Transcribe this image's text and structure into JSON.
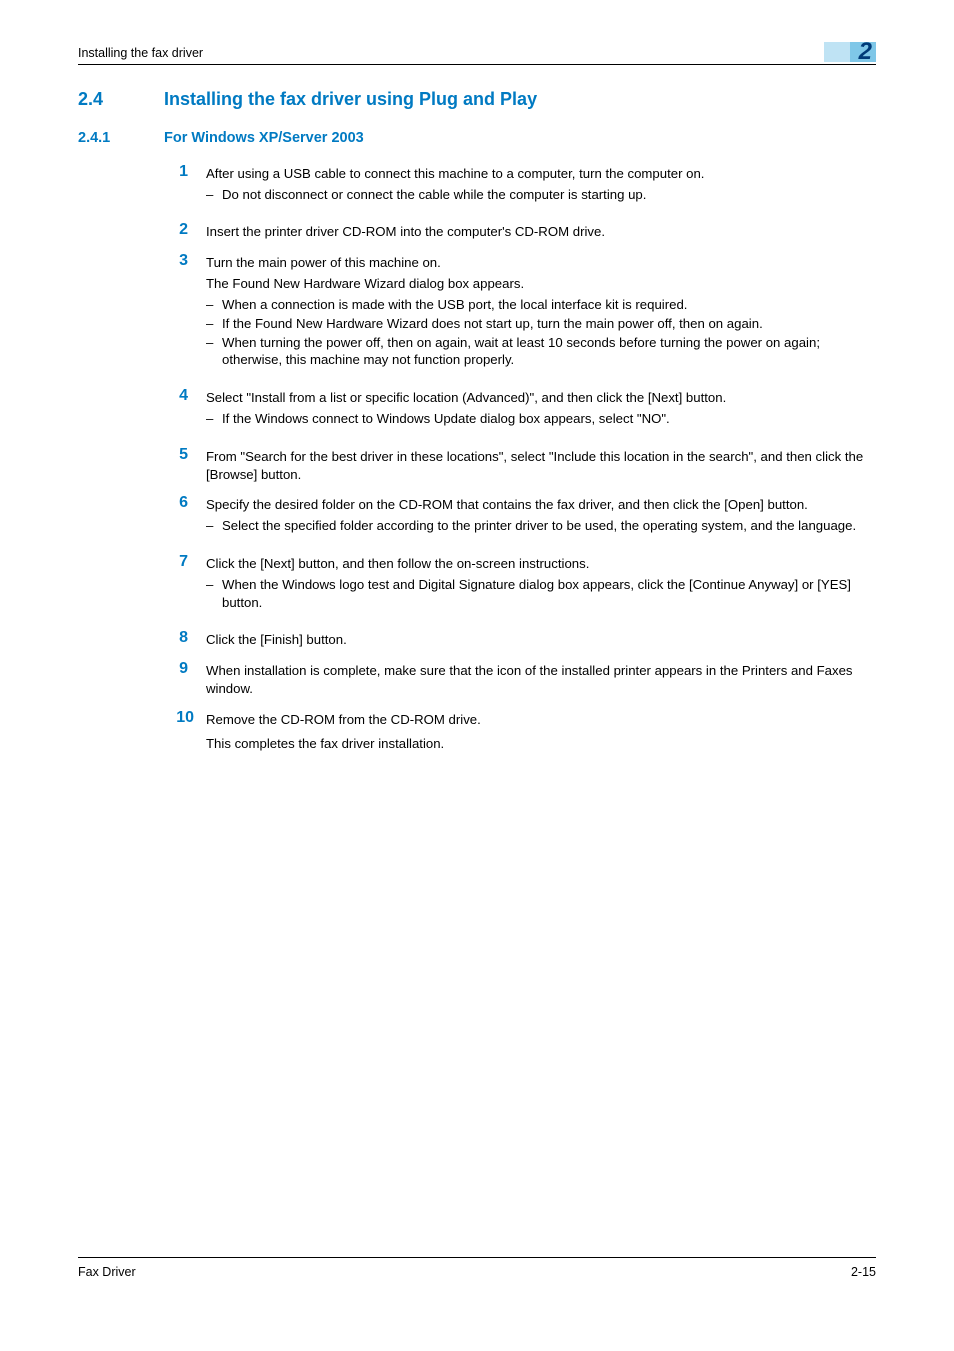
{
  "header": {
    "running_title": "Installing the fax driver",
    "chapter_number": "2"
  },
  "section": {
    "number": "2.4",
    "title": "Installing the fax driver using Plug and Play"
  },
  "subsection": {
    "number": "2.4.1",
    "title": "For Windows XP/Server 2003"
  },
  "steps": [
    {
      "n": "1",
      "text": "After using a USB cable to connect this machine to a computer, turn the computer on.",
      "subs": [
        "Do not disconnect or connect the cable while the computer is starting up."
      ]
    },
    {
      "n": "2",
      "text": "Insert the printer driver CD-ROM into the computer's CD-ROM drive."
    },
    {
      "n": "3",
      "text": "Turn the main power of this machine on.",
      "text2": "The Found New Hardware Wizard dialog box appears.",
      "subs": [
        "When a connection is made with the USB port, the local interface kit is required.",
        "If the Found New Hardware Wizard does not start up, turn the main power off, then on again.",
        "When turning the power off, then on again, wait at least 10 seconds before turning the power on again; otherwise, this machine may not function properly."
      ]
    },
    {
      "n": "4",
      "text": "Select \"Install from a list or specific location (Advanced)\", and then click the [Next] button.",
      "subs": [
        "If the Windows connect to Windows Update dialog box appears, select \"NO\"."
      ]
    },
    {
      "n": "5",
      "text": "From \"Search for the best driver in these locations\", select \"Include this location in the search\", and then click the [Browse] button."
    },
    {
      "n": "6",
      "text": "Specify the desired folder on the CD-ROM that contains the fax driver, and then click the [Open] button.",
      "subs": [
        "Select the specified folder according to the printer driver to be used, the operating system, and the language."
      ]
    },
    {
      "n": "7",
      "text": "Click the [Next] button, and then follow the on-screen instructions.",
      "subs": [
        "When the Windows logo test and Digital Signature dialog box appears, click the [Continue Anyway] or [YES] button."
      ]
    },
    {
      "n": "8",
      "text": "Click the [Finish] button."
    },
    {
      "n": "9",
      "text": "When installation is complete, make sure that the icon of the installed printer appears in the Printers and Faxes window."
    },
    {
      "n": "10",
      "text": "Remove the CD-ROM from the CD-ROM drive.",
      "trailing": "This completes the fax driver installation."
    }
  ],
  "footer": {
    "left": "Fax Driver",
    "right": "2-15"
  }
}
